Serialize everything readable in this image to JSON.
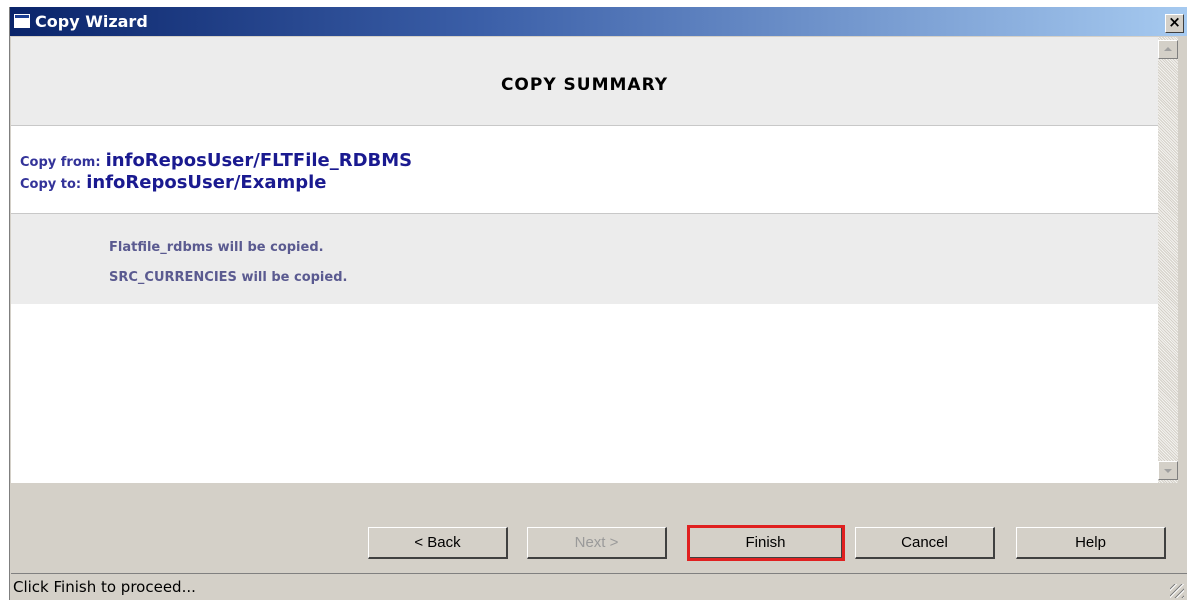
{
  "window": {
    "title": "Copy Wizard",
    "close_label": "×"
  },
  "summary": {
    "title": "COPY SUMMARY",
    "copy_from_label": "Copy from:",
    "copy_from_value": "infoReposUser/FLTFile_RDBMS",
    "copy_to_label": "Copy to:",
    "copy_to_value": "infoReposUser/Example",
    "items": [
      "Flatfile_rdbms will be copied.",
      "SRC_CURRENCIES will be copied."
    ]
  },
  "buttons": {
    "back": "< Back",
    "next": "Next >",
    "finish": "Finish",
    "cancel": "Cancel",
    "help": "Help"
  },
  "status": {
    "text": "Click Finish to proceed..."
  },
  "colors": {
    "highlight": "#e02020",
    "link_blue": "#1a1a90"
  }
}
